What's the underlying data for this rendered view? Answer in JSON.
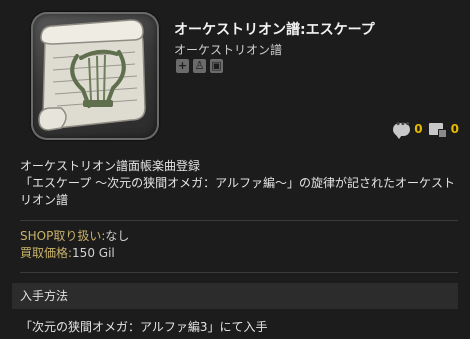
{
  "item": {
    "name": "オーケストリオン譜:エスケープ",
    "category": "オーケストリオン譜",
    "icon": "orchestrion-scroll-icon"
  },
  "class_icons": [
    "plus-icon",
    "crafter-icon",
    "chest-icon"
  ],
  "counters": {
    "comments": "0",
    "loadouts": "0"
  },
  "description": {
    "line1": "オーケストリオン譜面帳楽曲登録",
    "line2": "「エスケープ 〜次元の狭間オメガ：アルファ編〜」の旋律が記されたオーケストリオン譜"
  },
  "shop": {
    "shop_key": "SHOP取り扱い:",
    "shop_value": "なし",
    "price_key": "買取価格:",
    "price_value": "150 Gil"
  },
  "acquisition": {
    "header": "入手方法",
    "text": "「次元の狭間オメガ：アルファ編3」にて入手"
  },
  "colors": {
    "background": "#1c1c1c",
    "counter": "#e6b800",
    "label_gold": "#c9b26a"
  }
}
